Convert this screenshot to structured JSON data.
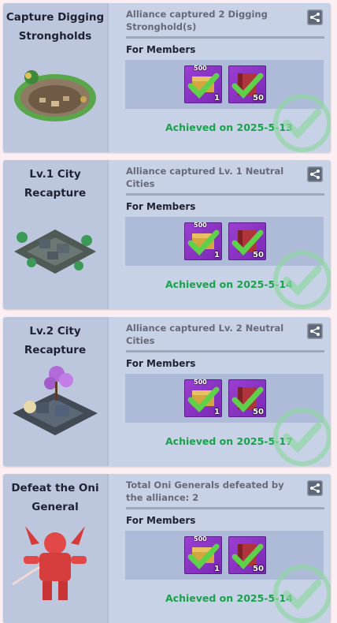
{
  "colors": {
    "achieved_green": "#18a24a",
    "card_bg": "#c8d2e6",
    "item_purple": "#8a33c4"
  },
  "cards": [
    {
      "title": "Capture Digging Strongholds",
      "description": "Alliance captured 2 Digging Stronghold(s)",
      "rewards_label": "For Members",
      "rewards": [
        {
          "tag": "500",
          "count": "1",
          "icon": "chest-item-icon"
        },
        {
          "tag": "",
          "count": "50",
          "icon": "red-book-item-icon"
        }
      ],
      "achieved": "Achieved on 2025-5-13",
      "art_icon": "digging-crater-art"
    },
    {
      "title": "Lv.1 City Recapture",
      "description": "Alliance captured Lv. 1 Neutral Cities",
      "rewards_label": "For Members",
      "rewards": [
        {
          "tag": "500",
          "count": "1",
          "icon": "chest-item-icon"
        },
        {
          "tag": "",
          "count": "50",
          "icon": "red-book-item-icon"
        }
      ],
      "achieved": "Achieved on 2025-5-14",
      "art_icon": "lv1-city-art"
    },
    {
      "title": "Lv.2 City Recapture",
      "description": "Alliance captured Lv. 2 Neutral Cities",
      "rewards_label": "For Members",
      "rewards": [
        {
          "tag": "500",
          "count": "1",
          "icon": "chest-item-icon"
        },
        {
          "tag": "",
          "count": "50",
          "icon": "red-book-item-icon"
        }
      ],
      "achieved": "Achieved on 2025-5-17",
      "art_icon": "lv2-city-art"
    },
    {
      "title": "Defeat the Oni General",
      "description": "Total Oni Generals defeated by the alliance: 2",
      "rewards_label": "For Members",
      "rewards": [
        {
          "tag": "500",
          "count": "1",
          "icon": "chest-item-icon"
        },
        {
          "tag": "",
          "count": "50",
          "icon": "red-book-item-icon"
        }
      ],
      "achieved": "Achieved on 2025-5-14",
      "art_icon": "oni-general-art"
    }
  ]
}
